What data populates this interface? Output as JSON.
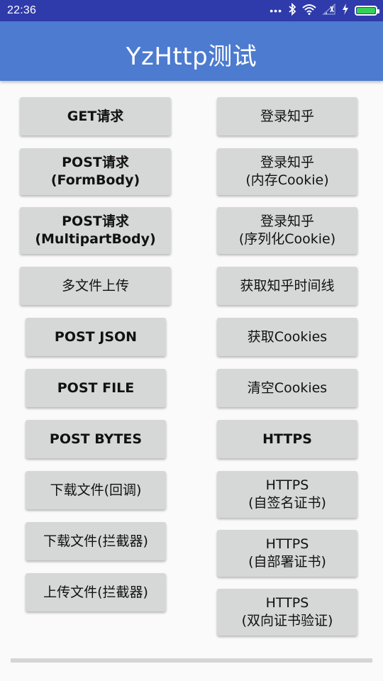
{
  "status_bar": {
    "time": "22:36",
    "icons": [
      "more-dots-icon",
      "bluetooth-icon",
      "wifi-icon",
      "signal-icon",
      "charging-icon",
      "battery-icon"
    ],
    "battery_color": "#34d058"
  },
  "toolbar": {
    "title": "YzHttp测试",
    "background": "#4c7bd0"
  },
  "left_buttons": [
    {
      "label": "GET请求"
    },
    {
      "label": "POST请求\n(FormBody)"
    },
    {
      "label": "POST请求\n(MultipartBody)"
    },
    {
      "label": "多文件上传"
    },
    {
      "label": "POST JSON"
    },
    {
      "label": "POST FILE"
    },
    {
      "label": "POST BYTES"
    },
    {
      "label": "下载文件(回调)"
    },
    {
      "label": "下载文件(拦截器)"
    },
    {
      "label": "上传文件(拦截器)"
    }
  ],
  "right_buttons": [
    {
      "label": "登录知乎"
    },
    {
      "label": "登录知乎\n(内存Cookie)"
    },
    {
      "label": "登录知乎\n(序列化Cookie)"
    },
    {
      "label": "获取知乎时间线"
    },
    {
      "label": "获取Cookies"
    },
    {
      "label": "清空Cookies"
    },
    {
      "label": "HTTPS"
    },
    {
      "label": "HTTPS\n(自签名证书)"
    },
    {
      "label": "HTTPS\n(自部署证书)"
    },
    {
      "label": "HTTPS\n(双向证书验证)"
    }
  ]
}
